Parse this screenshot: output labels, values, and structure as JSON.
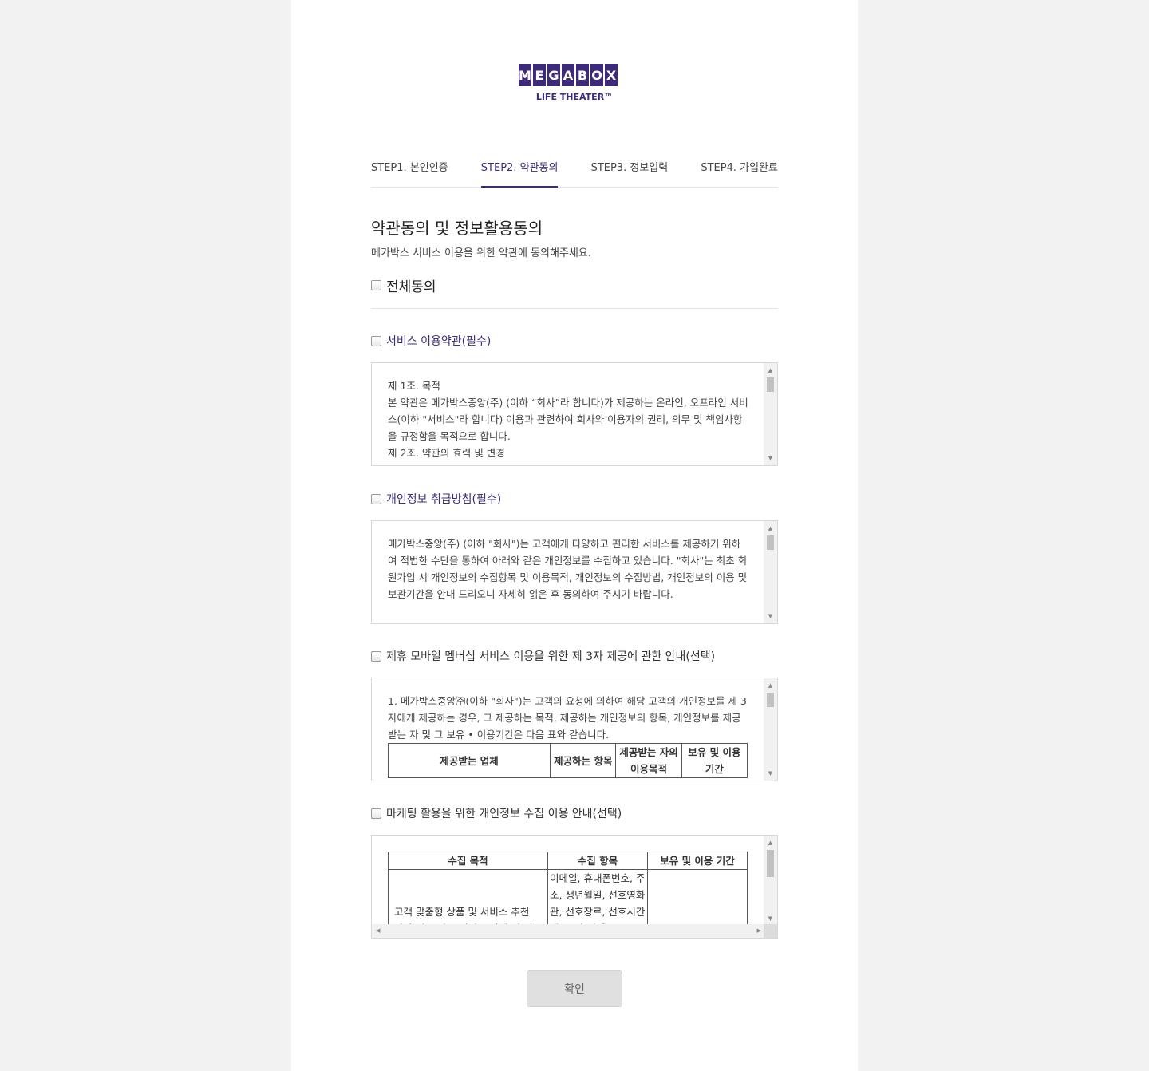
{
  "logo": {
    "letters": [
      "M",
      "E",
      "G",
      "A",
      "B",
      "O",
      "X"
    ],
    "subtitle": "LIFE THEATER™"
  },
  "steps": [
    {
      "label": "STEP1. 본인인증",
      "active": false
    },
    {
      "label": "STEP2. 약관동의",
      "active": true
    },
    {
      "label": "STEP3. 정보입력",
      "active": false
    },
    {
      "label": "STEP4. 가입완료",
      "active": false
    }
  ],
  "title": "약관동의 및 정보활용동의",
  "subtitle": "메가박스 서비스 이용을 위한 약관에 동의해주세요.",
  "agree_all": "전체동의",
  "terms": [
    {
      "label": "서비스 이용약관(필수)",
      "lines": [
        "제 1조. 목적",
        "본 약관은 메가박스중앙(주) (이하 “회사”라 합니다)가 제공하는 온라인, 오프라인 서비스(이하 \"서비스\"라 합니다) 이용과 관련하여 회사와 이용자의 권리, 의무 및 책임사항을 규정함을 목적으로 합니다.",
        "제 2조. 약관의 효력 및 변경"
      ]
    },
    {
      "label": "개인정보 취급방침(필수)",
      "lines": [
        "메가박스중앙(주) (이하 \"회사\")는 고객에게 다양하고 편리한 서비스를 제공하기 위하여 적법한 수단을 통하여 아래와 같은 개인정보를 수집하고 있습니다. \"회사\"는 최초 회원가입 시 개인정보의 수집항목 및 이용목적, 개인정보의 수집방법, 개인정보의 이용 및 보관기간을 안내 드리오니 자세히 읽은 후 동의하여 주시기 바랍니다."
      ]
    },
    {
      "label": "제휴 모바일 멤버십 서비스 이용을 위한 제 3자 제공에 관한 안내(선택)",
      "lines": [
        "1. 메가박스중앙㈜(이하 \"회사\")는 고객의 요청에 의하여 해당 고객의 개인정보를 제 3자에게 제공하는 경우, 그 제공하는 목적, 제공하는 개인정보의 항목, 개인정보를 제공받는 자 및 그 보유 • 이용기간은 다음 표와 같습니다."
      ],
      "table_headers": [
        "제공받는 업체",
        "제공하는 항목",
        "제공받는 자의 이용목적",
        "보유 및 이용기간"
      ]
    },
    {
      "label": "마케팅 활용을 위한 개인정보 수집 이용 안내(선택)",
      "table_headers": [
        "수집 목적",
        "수집 항목",
        "보유 및 이용 기간"
      ],
      "row_purpose": "고객 맞춤형 상품 및 서비스 추천",
      "row_purpose_cut": "당사 신규 상품/서비스 안내 및 권",
      "row_items": "이메일, 휴대폰번호, 주소, 생년월일, 선호영화관, 선호장르, 선호시간대, 문자/이메"
    }
  ],
  "confirm_button": "확인",
  "colors": {
    "accent": "#3d2a78",
    "background": "#f2f2f2"
  }
}
